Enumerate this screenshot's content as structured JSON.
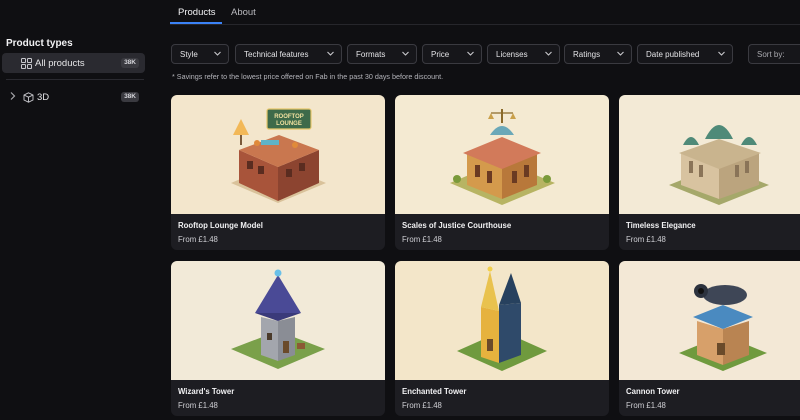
{
  "sidebar": {
    "title": "Product types",
    "items": [
      {
        "label": "All products",
        "count": "38K",
        "icon": "grid-icon"
      },
      {
        "label": "3D",
        "count": "38K",
        "icon": "cube-icon"
      }
    ]
  },
  "tabs": [
    {
      "label": "Products",
      "active": true
    },
    {
      "label": "About",
      "active": false
    }
  ],
  "filters": [
    "Style",
    "Technical features",
    "Formats",
    "Price",
    "Licenses",
    "Ratings",
    "Date published"
  ],
  "sort_label": "Sort by:",
  "note": "* Savings refer to the lowest price offered on Fab in the past 30 days before discount.",
  "products": [
    {
      "name": "Rooftop Lounge Model",
      "price": "From £1.48",
      "sign_text": "ROOFTOP LOUNGE"
    },
    {
      "name": "Scales of Justice Courthouse",
      "price": "From £1.48"
    },
    {
      "name": "Timeless Elegance",
      "price": "From £1.48"
    },
    {
      "name": "Wizard's Tower",
      "price": "From £1.48"
    },
    {
      "name": "Enchanted Tower",
      "price": "From £1.48"
    },
    {
      "name": "Cannon Tower",
      "price": "From £1.48"
    }
  ],
  "colors": {
    "background": "#0f0f12",
    "card": "#1d1d22",
    "accent": "#3b82f6",
    "thumb_bg": "#f3e9d4"
  }
}
